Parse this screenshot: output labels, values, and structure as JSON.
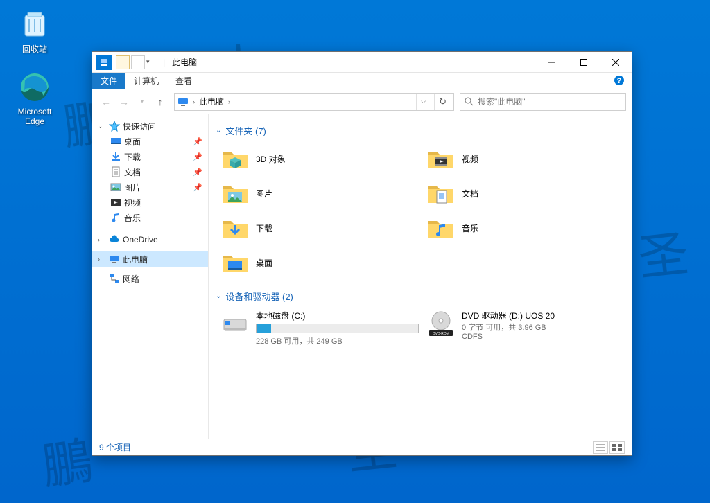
{
  "desktop": {
    "icons": [
      {
        "label": "回收站"
      },
      {
        "label": "Microsoft Edge"
      }
    ]
  },
  "window": {
    "title": "此电脑",
    "tabs": {
      "file": "文件",
      "computer": "计算机",
      "view": "查看"
    },
    "address": {
      "root": "此电脑",
      "search_placeholder": "搜索\"此电脑\""
    },
    "navpane": {
      "quick_access": "快速访问",
      "desktop": "桌面",
      "downloads": "下载",
      "documents": "文档",
      "pictures": "图片",
      "videos": "视频",
      "music": "音乐",
      "onedrive": "OneDrive",
      "this_pc": "此电脑",
      "network": "网络"
    },
    "content": {
      "folders_header": "文件夹 (7)",
      "folders": [
        {
          "label": "3D 对象"
        },
        {
          "label": "视频"
        },
        {
          "label": "图片"
        },
        {
          "label": "文档"
        },
        {
          "label": "下载"
        },
        {
          "label": "音乐"
        },
        {
          "label": "桌面"
        }
      ],
      "drives_header": "设备和驱动器 (2)",
      "drive_c": {
        "name": "本地磁盘 (C:)",
        "sub": "228 GB 可用，共 249 GB",
        "used_pct": 9
      },
      "drive_d": {
        "name": "DVD 驱动器 (D:) UOS 20",
        "line2": "0 字节 可用，共 3.96 GB",
        "line3": "CDFS"
      }
    },
    "status": {
      "count": "9 个项目"
    }
  },
  "watermark": {
    "a": "鵬",
    "b": "大",
    "c": "圣"
  }
}
